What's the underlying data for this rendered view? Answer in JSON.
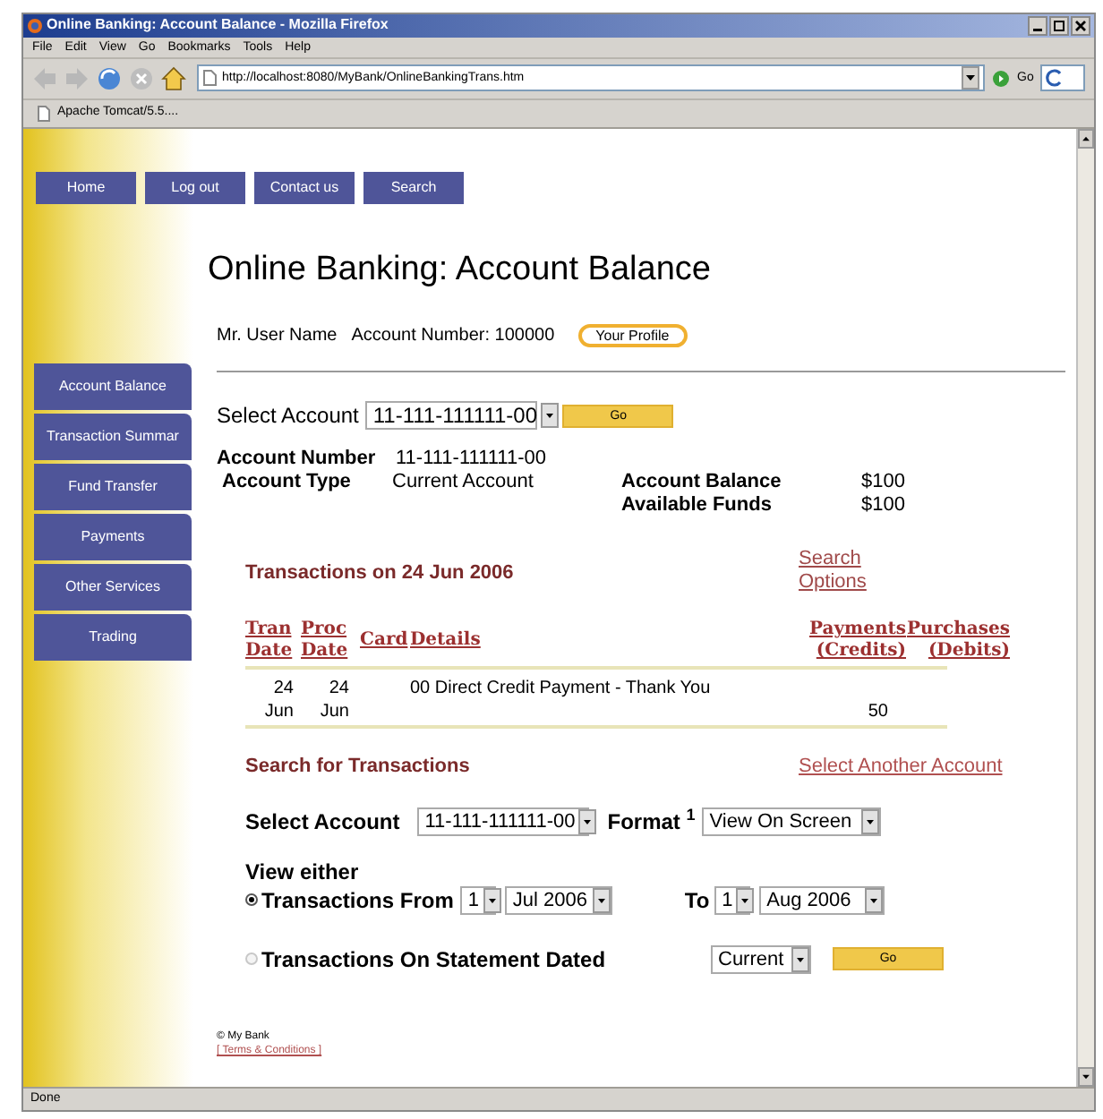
{
  "window": {
    "title": "Online Banking: Account Balance - Mozilla Firefox"
  },
  "menu": [
    "File",
    "Edit",
    "View",
    "Go",
    "Bookmarks",
    "Tools",
    "Help"
  ],
  "toolbar": {
    "address": "http://localhost:8080/MyBank/OnlineBankingTrans.htm",
    "go": "Go"
  },
  "bookmarks": [
    "Apache Tomcat/5.5...."
  ],
  "top_nav": [
    "Home",
    "Log out",
    "Contact us",
    "Search"
  ],
  "sidebar": {
    "items": [
      "Account Balance",
      "Transaction Summar",
      "Fund Transfer",
      "Payments",
      "Other Services",
      "Trading"
    ]
  },
  "page_title": "Online Banking: Account Balance",
  "user": {
    "name": "Mr. User Name",
    "account": "Account Number: 100000",
    "profile_button": "Your Profile"
  },
  "account_select": {
    "label": "Select Account",
    "value": "11-111-111111-00",
    "go": "Go"
  },
  "account_details": {
    "number_label": "Account Number",
    "number": "11-111-111111-00",
    "type_label": "Account Type",
    "type": "Current Account",
    "balance_label": "Account Balance",
    "balance": "$100",
    "funds_label": "Available Funds",
    "funds": "$100"
  },
  "transactions": {
    "title": "Transactions on 24 Jun 2006",
    "link": "Search Options",
    "columns": [
      "Tran Date",
      "Proc Date",
      "Card",
      "Details",
      "Payments (Credits)",
      "Purchases (Debits)"
    ],
    "rows": [
      {
        "tran_date": "24 Jun",
        "proc_date": "24 Jun",
        "details": "00 Direct Credit Payment - Thank You",
        "payments": "50"
      }
    ]
  },
  "search": {
    "title": "Search for Transactions",
    "link": "Select Another Account",
    "account_label": "Select Account",
    "account": "11-111-111111-00",
    "format_label": "Format $^{1}$",
    "format": "View On Screen",
    "view_either": "View either",
    "options": [
      {
        "label": "Transactions From",
        "selected": true
      },
      {
        "label": "Transactions On Statement Dated",
        "selected": false
      }
    ],
    "from_day": "1",
    "from_month": "Jul 2006",
    "to_label": "To",
    "to_day": "1",
    "to_month": "Aug 2006",
    "statement": "Current",
    "go": "Go"
  },
  "footer": {
    "copyright": "© My Bank",
    "terms": "[ Terms & Conditions ]"
  },
  "status_bar": "Done"
}
